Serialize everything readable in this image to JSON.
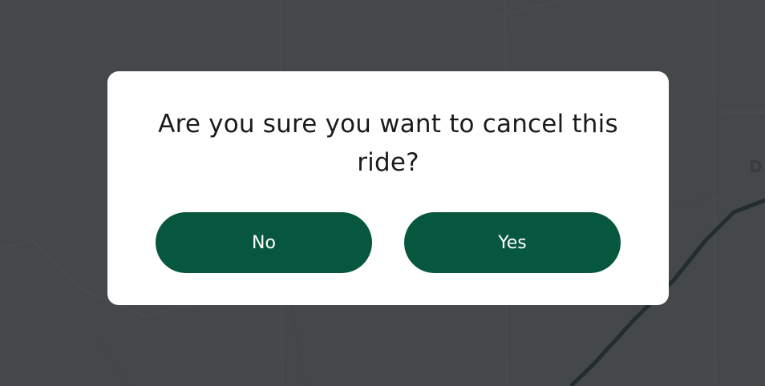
{
  "dialog": {
    "message": "Are you sure you want to cancel this ride?",
    "no_label": "No",
    "yes_label": "Yes"
  },
  "map": {
    "partial_label": "D"
  },
  "colors": {
    "button_bg": "#07573f",
    "button_text": "#ffffff",
    "overlay": "#3d4043",
    "route": "#0b3a2a"
  }
}
